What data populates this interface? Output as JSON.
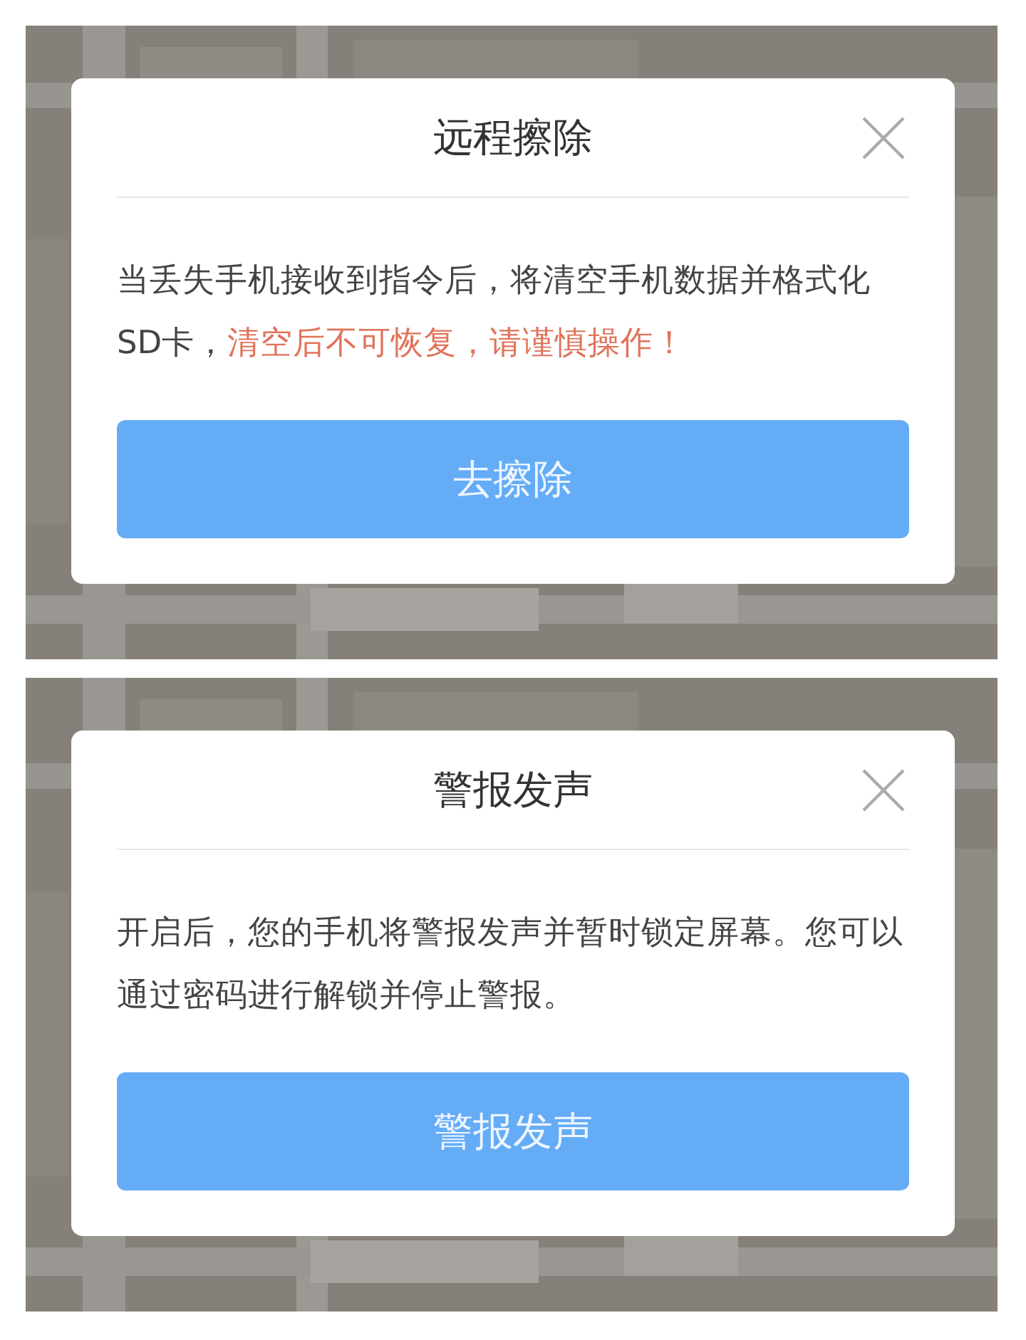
{
  "dialogs": [
    {
      "background": {
        "kind": "picture"
      },
      "title": "远程擦除",
      "body": [
        {
          "kind": "normal",
          "text": "当丢失手机接收到指令后，将清空手机数据并格式化SD卡，"
        },
        {
          "kind": "warning",
          "text": "清空后不可恢复，请谨慎操作！"
        }
      ],
      "button": "去擦除"
    },
    {
      "background": {
        "kind": "picture"
      },
      "title": "警报发声",
      "body": [
        {
          "kind": "normal",
          "text": "开启后，您的手机将警报发声并暂时锁定屏幕。您可以通过密码进行解锁并停止警报。"
        }
      ],
      "button": "警报发声"
    }
  ]
}
